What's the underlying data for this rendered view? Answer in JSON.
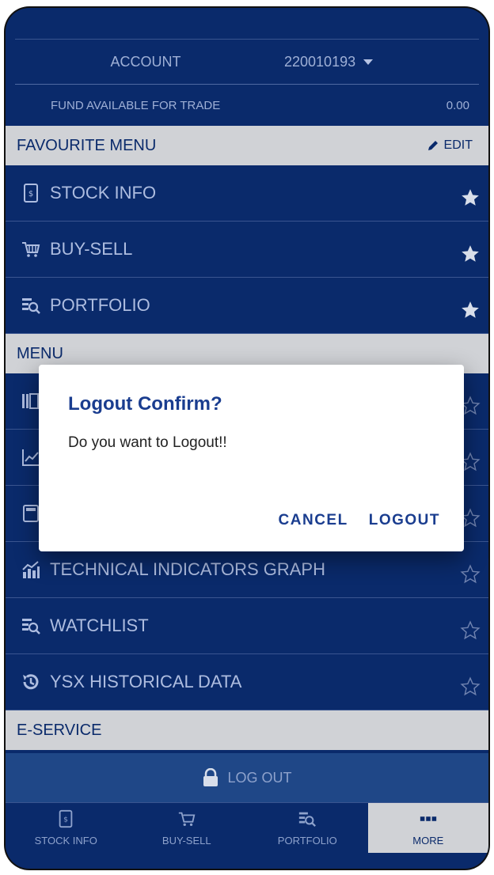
{
  "account": {
    "label": "ACCOUNT",
    "number": "220010193"
  },
  "fund": {
    "label": "FUND AVAILABLE FOR TRADE",
    "value": "0.00"
  },
  "favourite": {
    "title": "FAVOURITE MENU",
    "edit_label": "EDIT",
    "items": [
      {
        "label": "STOCK INFO",
        "icon": "stock-info-icon"
      },
      {
        "label": "BUY-SELL",
        "icon": "cart-icon"
      },
      {
        "label": "PORTFOLIO",
        "icon": "portfolio-icon"
      }
    ]
  },
  "menu": {
    "title": "MENU",
    "items": [
      {
        "label": "",
        "icon": "book-icon"
      },
      {
        "label": "",
        "icon": "chart-icon"
      },
      {
        "label": "",
        "icon": "calculator-icon"
      },
      {
        "label": "TECHNICAL INDICATORS GRAPH",
        "icon": "bar-graph-icon"
      },
      {
        "label": "WATCHLIST",
        "icon": "watchlist-icon"
      },
      {
        "label": "YSX HISTORICAL DATA",
        "icon": "history-icon"
      }
    ]
  },
  "eservice": {
    "title": "E-SERVICE"
  },
  "logout_bar": {
    "label": "LOG OUT"
  },
  "bottom_nav": [
    {
      "label": "STOCK INFO",
      "icon": "stock-info-icon"
    },
    {
      "label": "BUY-SELL",
      "icon": "cart-icon"
    },
    {
      "label": "PORTFOLIO",
      "icon": "portfolio-icon"
    },
    {
      "label": "MORE",
      "icon": "more-icon",
      "active": true
    }
  ],
  "dialog": {
    "title": "Logout Confirm?",
    "message": "Do you want to Logout!!",
    "cancel_label": "CANCEL",
    "logout_label": "LOGOUT"
  },
  "colors": {
    "primary": "#0a2a6b",
    "section": "#d0d2d6",
    "accent": "#1a3d8f"
  }
}
